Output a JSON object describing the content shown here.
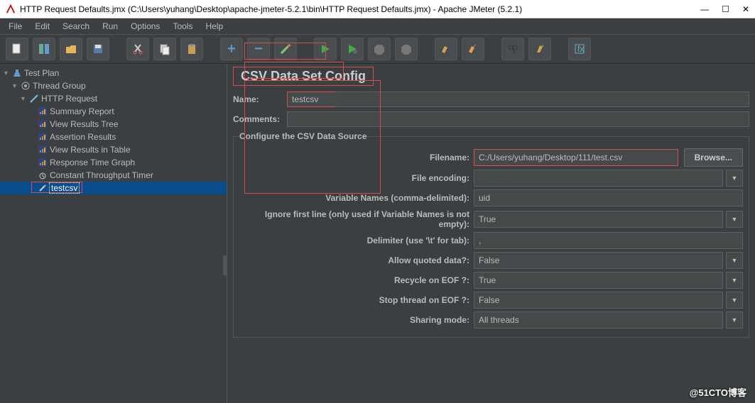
{
  "window": {
    "title": "HTTP Request Defaults.jmx (C:\\Users\\yuhang\\Desktop\\apache-jmeter-5.2.1\\bin\\HTTP Request Defaults.jmx) - Apache JMeter (5.2.1)",
    "min": "—",
    "max": "☐",
    "close": "✕"
  },
  "menus": {
    "file": "File",
    "edit": "Edit",
    "search": "Search",
    "run": "Run",
    "options": "Options",
    "tools": "Tools",
    "help": "Help"
  },
  "tree": {
    "test_plan": "Test Plan",
    "thread_group": "Thread Group",
    "http_request": "HTTP Request",
    "summary_report": "Summary Report",
    "view_results_tree": "View Results Tree",
    "assertion_results": "Assertion Results",
    "view_results_in_table": "View Results in Table",
    "response_time_graph": "Response Time Graph",
    "constant_throughput_timer": "Constant Throughput Timer",
    "testcsv": "testcsv"
  },
  "panel": {
    "title": "CSV Data Set Config",
    "name_label": "Name:",
    "name_value": "testcsv",
    "comments_label": "Comments:",
    "comments_value": "",
    "legend": "Configure the CSV Data Source",
    "browse": "Browse...",
    "fields": {
      "filename_label": "Filename:",
      "filename_value": "C:/Users/yuhang/Desktop/111/test.csv",
      "file_encoding_label": "File encoding:",
      "file_encoding_value": "",
      "variable_names_label": "Variable Names (comma-delimited):",
      "variable_names_value": "uid",
      "ignore_first_line_label": "Ignore first line (only used if Variable Names is not empty):",
      "ignore_first_line_value": "True",
      "delimiter_label": "Delimiter (use '\\t' for tab):",
      "delimiter_value": ",",
      "allow_quoted_label": "Allow quoted data?:",
      "allow_quoted_value": "False",
      "recycle_eof_label": "Recycle on EOF ?:",
      "recycle_eof_value": "True",
      "stop_thread_eof_label": "Stop thread on EOF ?:",
      "stop_thread_eof_value": "False",
      "sharing_mode_label": "Sharing mode:",
      "sharing_mode_value": "All threads"
    }
  },
  "watermark": "@51CTO博客"
}
